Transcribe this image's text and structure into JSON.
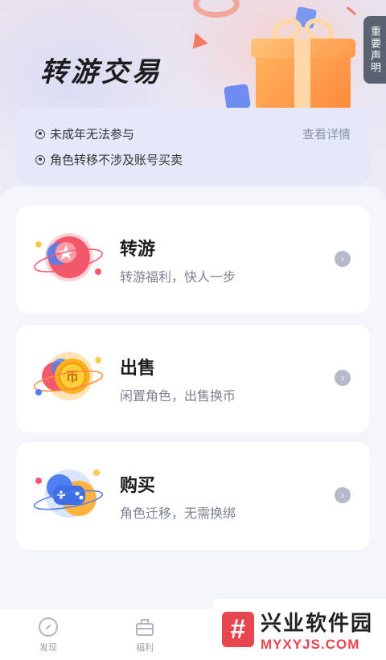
{
  "header": {
    "title": "转游交易",
    "notice_tab": "重要声明"
  },
  "info": {
    "items": [
      "未成年无法参与",
      "角色转移不涉及账号买卖"
    ],
    "detail_link": "查看详情"
  },
  "cards": [
    {
      "title": "转游",
      "subtitle": "转游福利，快人一步",
      "icon": "star-planet-icon"
    },
    {
      "title": "出售",
      "subtitle": "闲置角色，出售换币",
      "icon": "coin-planet-icon"
    },
    {
      "title": "购买",
      "subtitle": "角色迁移，无需换绑",
      "icon": "gamepad-planet-icon"
    }
  ],
  "tabbar": {
    "items": [
      {
        "label": "发现",
        "icon": "compass-icon"
      },
      {
        "label": "福利",
        "icon": "gift-box-icon"
      }
    ]
  },
  "watermark": {
    "logo": "#",
    "name": "兴业软件园",
    "domain": "MYXYJS.COM"
  },
  "colors": {
    "accent": "#e8464f",
    "info_bg": "#e4e8f8",
    "gift": "#ff8a3c"
  }
}
